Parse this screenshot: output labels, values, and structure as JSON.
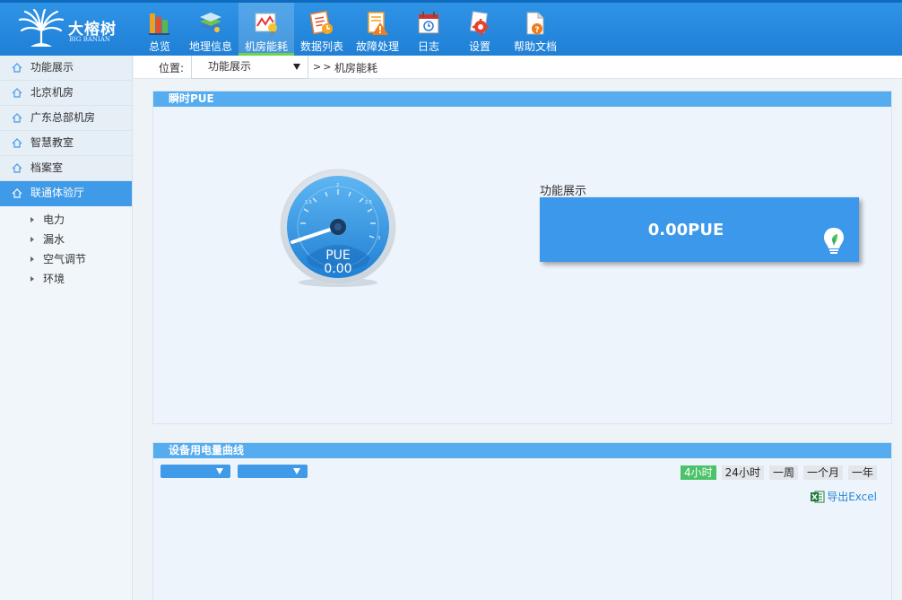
{
  "brand": {
    "name": "大榕树",
    "sub": "BIG BANIAN"
  },
  "nav": [
    {
      "label": "总览",
      "icon": "books-icon"
    },
    {
      "label": "地理信息",
      "icon": "map-layers-icon"
    },
    {
      "label": "机房能耗",
      "icon": "energy-chart-icon",
      "active": true
    },
    {
      "label": "数据列表",
      "icon": "data-list-icon"
    },
    {
      "label": "故障处理",
      "icon": "warning-doc-icon"
    },
    {
      "label": "日志",
      "icon": "calendar-log-icon"
    },
    {
      "label": "设置",
      "icon": "settings-gear-icon"
    },
    {
      "label": "帮助文档",
      "icon": "help-doc-icon"
    }
  ],
  "sidebar": {
    "items": [
      {
        "label": "功能展示"
      },
      {
        "label": "北京机房"
      },
      {
        "label": "广东总部机房"
      },
      {
        "label": "智慧教室"
      },
      {
        "label": "档案室"
      },
      {
        "label": "联通体验厅",
        "active": true
      }
    ],
    "subitems": [
      {
        "label": "电力"
      },
      {
        "label": "漏水"
      },
      {
        "label": "空气调节"
      },
      {
        "label": "环境"
      }
    ]
  },
  "location": {
    "label": "位置:",
    "selected": "功能展示",
    "separator": ">>",
    "current": "机房能耗"
  },
  "pue_panel": {
    "title": "瞬时PUE",
    "gauge": {
      "label": "PUE",
      "value_text": "0.00",
      "value": 0.0,
      "ticks": [
        "1.5",
        "2",
        "2.5",
        "3"
      ]
    },
    "card_label": "功能展示",
    "card_value": "0.00PUE"
  },
  "power_panel": {
    "title": "设备用电量曲线",
    "ranges": [
      {
        "label": "4小时",
        "active": true
      },
      {
        "label": "24小时"
      },
      {
        "label": "一周"
      },
      {
        "label": "一个月"
      },
      {
        "label": "一年"
      }
    ],
    "export_label": "导出Excel"
  },
  "colors": {
    "topbar": "#2f93e6",
    "accent": "#3f9ae8",
    "panel_head": "#55acee",
    "active_range": "#4cc36a",
    "nav_active_underline": "#6cd34a"
  }
}
